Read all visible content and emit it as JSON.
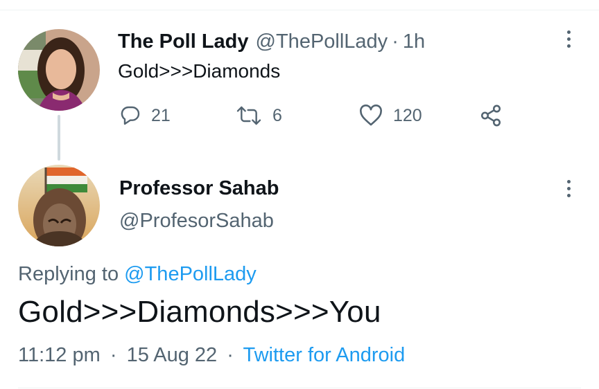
{
  "parent_tweet": {
    "display_name": "The Poll Lady",
    "handle": "@ThePollLady",
    "separator": "·",
    "time": "1h",
    "text": "Gold>>>Diamonds",
    "stats": {
      "replies": "21",
      "retweets": "6",
      "likes": "120"
    },
    "icons": {
      "reply": "reply-icon",
      "retweet": "retweet-icon",
      "like": "heart-icon",
      "share": "share-icon",
      "more": "more-vertical-icon"
    }
  },
  "reply_tweet": {
    "display_name": "Professor Sahab",
    "handle": "@ProfesorSahab",
    "replying_prefix": "Replying to",
    "replying_to": "@ThePollLady",
    "text": "Gold>>>Diamonds>>>You",
    "time": "11:12 pm",
    "separator": "·",
    "date": "15 Aug 22",
    "source": "Twitter for Android"
  },
  "colors": {
    "text_primary": "#0f1419",
    "text_secondary": "#536471",
    "link": "#1d9bf0",
    "divider": "#eff3f4",
    "thread_line": "#cfd9de"
  }
}
